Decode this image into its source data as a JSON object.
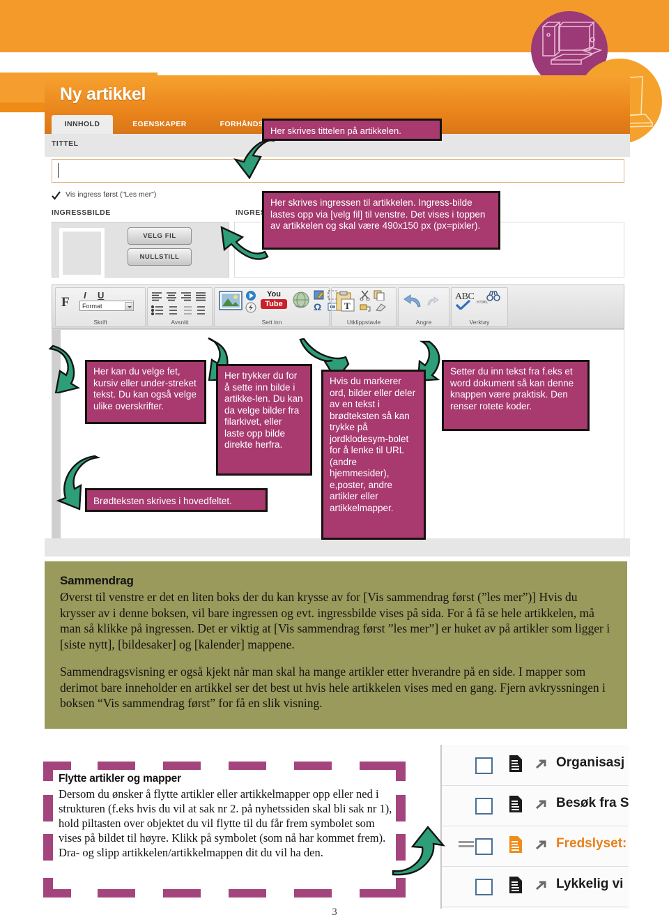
{
  "page": {
    "number": "3"
  },
  "badges": [
    {
      "name": "desktop-computer-illustration",
      "color": "#9c3977"
    },
    {
      "name": "laptop-presentation-illustration",
      "color": "#f5a22c"
    }
  ],
  "cms": {
    "title": "Ny artikkel",
    "tabs": [
      {
        "label": "INNHOLD",
        "active": true
      },
      {
        "label": "EGENSKAPER",
        "active": false
      },
      {
        "label": "FORHÅNDSVIS",
        "active": false
      }
    ],
    "fields": {
      "tittel_label": "TITTEL",
      "tittel_value": "",
      "checkbox_label": "Vis ingress først (\"Les mer\")",
      "checkbox_checked": true,
      "ingressbilde_label": "INGRESSBILDE",
      "ingress_label": "INGRESS",
      "velg_fil_button": "VELG FIL",
      "nullstill_button": "NULLSTILL"
    },
    "ribbon": {
      "format_select_value": "Format",
      "groups": [
        {
          "caption": "Skrift"
        },
        {
          "caption": "Avsnitt"
        },
        {
          "caption": "Sett inn"
        },
        {
          "caption": "Utklippstavle"
        },
        {
          "caption": "Angre"
        },
        {
          "caption": "Verktøy"
        }
      ],
      "bold_glyph": "F",
      "italic_glyph": "I",
      "underline_glyph": "U",
      "youtube_top": "You",
      "youtube_bottom": "Tube",
      "omega_glyph": "Ω",
      "abc_glyph": "ABC",
      "html_glyph": "HTML"
    }
  },
  "callouts": {
    "tittel": "Her skrives tittelen på artikkelen.",
    "ingress": "Her skrives ingressen til artikkelen. Ingress-bilde lastes opp via [velg fil] til venstre. Det vises i toppen av artikkelen og skal være 490x150 px (px=pixler).",
    "skrift": "Her kan du velge fet, kursiv eller under-streket tekst. Du kan også velge ulike overskrifter.",
    "brodtekst": "Brødteksten skrives i hovedfeltet.",
    "bilde": "Her trykker du for å sette inn bilde i artikke-len. Du kan da velge bilder fra filarkivet, eller laste opp bilde direkte herfra.",
    "jordklode": "Hvis du markerer ord, bilder eller deler av en tekst i brødteksten så kan trykke på jordklodesym-bolet for å lenke til URL (andre hjemmesider), e,poster, andre artikler eller artikkelmapper.",
    "word": "Setter du inn tekst fra f.eks et word dokument så kan denne knappen være praktisk. Den renser rotete koder."
  },
  "summary": {
    "heading": "Sammendrag",
    "paragraph1": "Øverst til venstre er det en liten boks der du kan krysse av for [Vis sammendrag først (”les mer”)] Hvis du krysser av i denne boksen, vil bare ingressen og evt. ingressbilde vises på sida. For å få se hele artikkelen, må man så klikke på ingressen. Det er viktig at [Vis sammendrag først ”les mer”] er huket av på artikler som ligger i [siste nytt], [bildesaker] og [kalender] mappene.",
    "paragraph2": "Sammendragsvisning er også kjekt når man skal ha mange artikler etter hverandre på en side. I mapper som derimot bare inneholder en artikkel ser det best ut hvis hele artikkelen vises med en gang. Fjern avkryssningen i boksen “Vis sammendrag først” for få en slik visning."
  },
  "move": {
    "heading": "Flytte artikler og mapper",
    "paragraph": "Dersom du ønsker å flytte artikler eller artikkelmapper opp eller ned i strukturen (f.eks hvis du vil at sak nr 2. på nyhetssiden skal bli sak nr 1), hold piltasten over objektet du vil flytte til du får frem symbolet som vises på bildet til høyre. Klikk på symbolet (som nå har kommet frem). Dra- og slipp artikkelen/artikkelmappen dit du vil ha den."
  },
  "list_screenshot": {
    "rows": [
      {
        "label": "Organisasj",
        "selected": false,
        "grip": false
      },
      {
        "label": "Besøk fra S",
        "selected": false,
        "grip": false
      },
      {
        "label": "Fredslyset:",
        "selected": true,
        "grip": true
      },
      {
        "label": "Lykkelig vi",
        "selected": false,
        "grip": false
      }
    ]
  },
  "colors": {
    "orange_band": "#f39a2b",
    "cms_orange": "#e8821a",
    "callout_magenta": "#a83a70",
    "arrow_green": "#2e9e78",
    "summary_olive": "#9a9a5c",
    "dash_purple": "#a3457c",
    "selected_row_orange": "#e8801c"
  }
}
